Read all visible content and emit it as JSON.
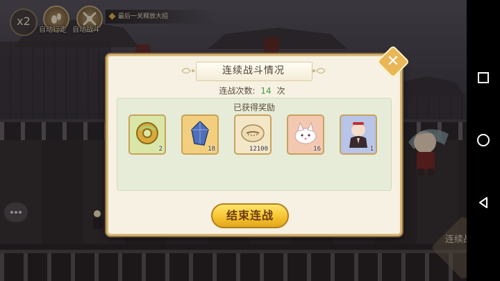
{
  "hud": {
    "speed_label": "x2",
    "auto_move_label": "自动行走",
    "auto_battle_label": "自动战斗",
    "tip_text": "最后一关释放大招",
    "continue_battle_label": "连续战斗"
  },
  "dialog": {
    "title": "连续战斗情况",
    "battle_count_label": "连战次数:",
    "battle_count_value": "14",
    "battle_count_unit": "次",
    "rewards_title": "已获得奖励",
    "rewards": [
      {
        "icon": "gold-ring-icon",
        "qty": "2",
        "bg": "#d8e7a8"
      },
      {
        "icon": "blue-crystal-icon",
        "qty": "18",
        "bg": "#f2cf7e"
      },
      {
        "icon": "shell-coin-icon",
        "qty": "12100",
        "bg": "#f3e7c8"
      },
      {
        "icon": "white-fox-plush-icon",
        "qty": "16",
        "bg": "#f2c8b0"
      },
      {
        "icon": "character-portrait-icon",
        "qty": "1",
        "bg": "#b8c4e8"
      }
    ],
    "end_button_label": "结束连战",
    "close_icon": "close-icon"
  },
  "colors": {
    "count_green": "#3e9c3e",
    "button_gold": "#f6c431",
    "panel_bg": "#e6ecd8"
  }
}
